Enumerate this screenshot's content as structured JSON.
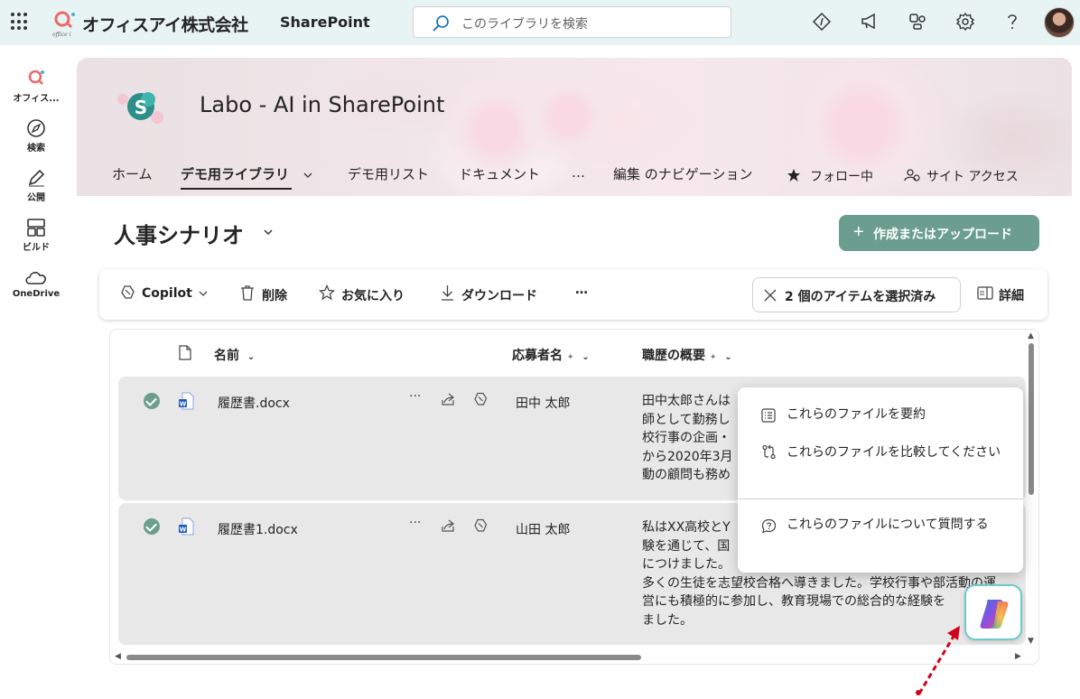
{
  "suite": {
    "org_name": "オフィスアイ株式会社",
    "logo_text": "office i",
    "app_name": "SharePoint",
    "search_placeholder": "このライブラリを検索"
  },
  "rail": {
    "items": [
      {
        "label": "オフィス..."
      },
      {
        "label": "検索"
      },
      {
        "label": "公開"
      },
      {
        "label": "ビルド"
      },
      {
        "label": "OneDrive"
      }
    ]
  },
  "site": {
    "logo_letter": "S",
    "title": "Labo - AI in SharePoint",
    "nav": {
      "home": "ホーム",
      "demo_library": "デモ用ライブラリ",
      "demo_list": "デモ用リスト",
      "documents": "ドキュメント",
      "more": "…",
      "edit_nav": "編集 のナビゲーション",
      "following": "フォロー中",
      "site_access": "サイト アクセス"
    }
  },
  "library": {
    "title": "人事シナリオ",
    "create_label": "作成またはアップロード"
  },
  "commands": {
    "copilot": "Copilot",
    "delete": "削除",
    "favorite": "お気に入り",
    "download": "ダウンロード",
    "more": "…",
    "selected": "2 個のアイテムを選択済み",
    "details": "詳細"
  },
  "columns": {
    "name": "名前",
    "applicant": "応募者名",
    "career": "職歴の概要"
  },
  "rows": [
    {
      "name": "履歴書.docx",
      "applicant": "田中 太郎",
      "summary": [
        "田中太郎さんは",
        "師として勤務し",
        "校行事の企画・",
        "から2020年3月",
        "動の顧問も務め"
      ]
    },
    {
      "name": "履歴書1.docx",
      "applicant": "山田 太郎",
      "summary": [
        "私はXX高校とY",
        "験を通じて、国",
        "につけました。",
        "多くの生徒を志望校合格へ導きました。学校行事や部活動の運",
        "営にも積極的に参加し、教育現場での総合的な経験を",
        "ました。"
      ]
    }
  ],
  "copilot_menu": {
    "summarize": "これらのファイルを要約",
    "compare": "これらのファイルを比較してください",
    "ask": "これらのファイルについて質問する"
  },
  "colors": {
    "suite_bg": "#e8f4f4",
    "accent_green": "#6b9e8e",
    "row_selected": "#e8e8e8",
    "arrow_red": "#d0021b"
  }
}
